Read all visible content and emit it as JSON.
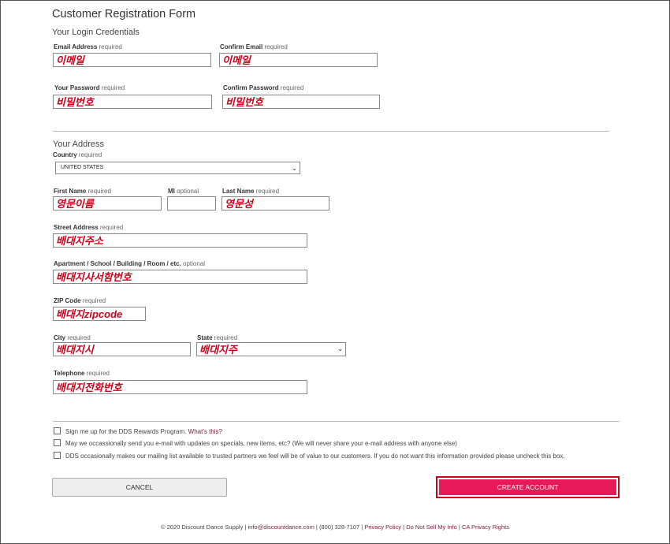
{
  "page": {
    "title": "Customer Registration Form"
  },
  "login": {
    "heading": "Your Login Credentials",
    "email_label": "Email Address",
    "email_req": "required",
    "email_value": "이메일",
    "confirm_email_label": "Confirm Email",
    "confirm_email_req": "required",
    "confirm_email_value": "이메일",
    "password_label": "Your Password",
    "password_req": "required",
    "password_value": "비밀번호",
    "confirm_password_label": "Confirm Password",
    "confirm_password_req": "required",
    "confirm_password_value": "비밀번호"
  },
  "address": {
    "heading": "Your Address",
    "country_label": "Country",
    "country_req": "required",
    "country_value": "UNITED STATES",
    "first_name_label": "First Name",
    "first_name_req": "required",
    "first_name_value": "영문이름",
    "mi_label": "MI",
    "mi_req": "optional",
    "last_name_label": "Last Name",
    "last_name_req": "required",
    "last_name_value": "영문성",
    "street_label": "Street Address",
    "street_req": "required",
    "street_value": "배대지주소",
    "apt_label": "Apartment / School / Building / Room / etc.",
    "apt_req": "optional",
    "apt_value": "배대지사서함번호",
    "zip_label": "ZIP Code",
    "zip_req": "required",
    "zip_value": "배대지zipcode",
    "city_label": "City",
    "city_req": "required",
    "city_value": "배대지시",
    "state_label": "State",
    "state_req": "required",
    "state_value": "배대지주",
    "phone_label": "Telephone",
    "phone_req": "required",
    "phone_value": "배대지전화번호"
  },
  "options": {
    "rewards_text": "Sign me up for the DDS Rewards Program.",
    "rewards_link": "What's this?",
    "email_updates_text": "May we occassionally send you e-mail with updates on specials, new items, etc? (We will never share your e-mail address with anyone else)",
    "partners_text": "DDS occasionally makes our mailing list available to trusted partners we feel will be of value to our customers. If you do not want this information provided please uncheck this box."
  },
  "buttons": {
    "cancel": "CANCEL",
    "create": "CREATE ACCOUNT"
  },
  "footer": {
    "copyright": "© 2020 Discount Dance Supply |",
    "email": "info@discountdance.com",
    "phone": "| (800) 328-7107 |",
    "privacy": "Privacy Policy",
    "sep1": "|",
    "dnsmpi": "Do Not Sell My Info",
    "sep2": "|",
    "ca_privacy": "CA Privacy Rights"
  },
  "colors": {
    "accent": "#e8195a",
    "annotation": "#d0021b",
    "link": "#7a1a3c"
  }
}
